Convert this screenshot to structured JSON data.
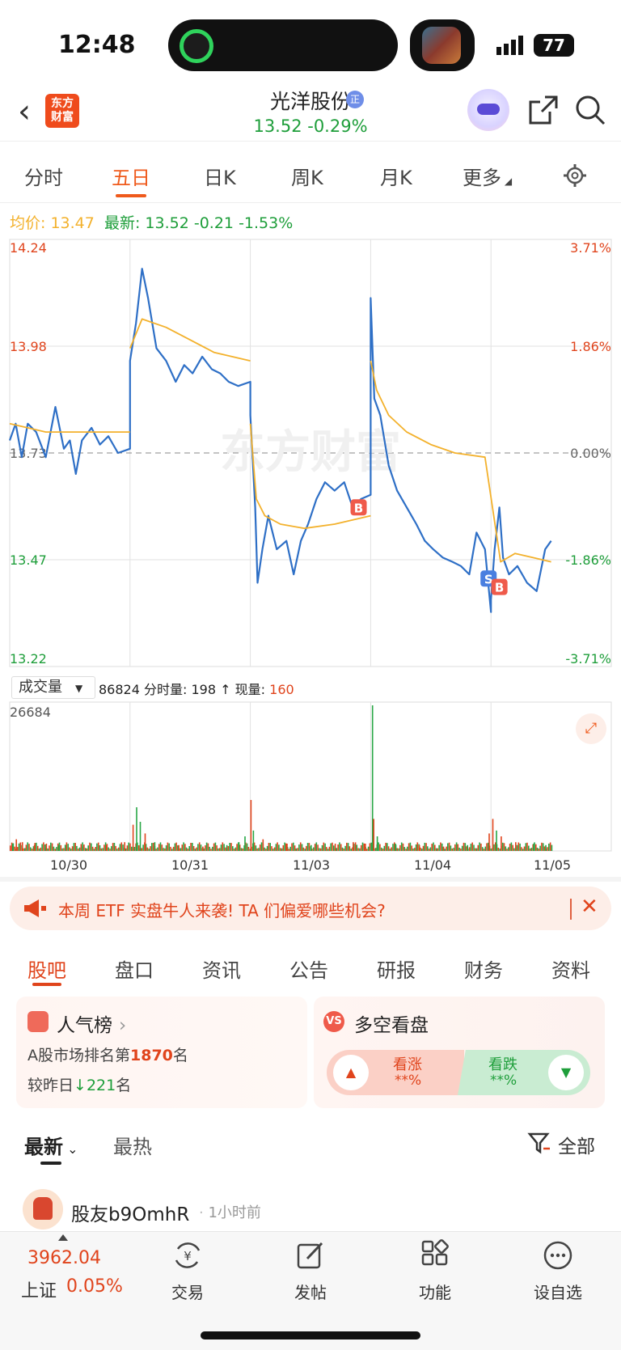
{
  "status_bar": {
    "time": "12:48",
    "battery": "77"
  },
  "header": {
    "logo": [
      "东方",
      "财富"
    ],
    "stock_name": "光洋股份",
    "stock_badge": "正",
    "price_line": "13.52  -0.29%"
  },
  "period_tabs": [
    {
      "label": "分时",
      "active": false
    },
    {
      "label": "五日",
      "active": true
    },
    {
      "label": "日K",
      "active": false
    },
    {
      "label": "周K",
      "active": false
    },
    {
      "label": "月K",
      "active": false
    },
    {
      "label": "更多",
      "active": false
    }
  ],
  "info_line": {
    "avg_label": "均价:",
    "avg_value": "13.47",
    "latest_label": "最新:",
    "latest_value": "13.52",
    "change": "-0.21",
    "change_pct": "-1.53%"
  },
  "chart_data": {
    "type": "line",
    "title": "",
    "watermark": "东方财富",
    "days": [
      "10/30",
      "10/31",
      "11/03",
      "11/04",
      "11/05"
    ],
    "ylim": [
      13.22,
      14.24
    ],
    "y_ticks_left": [
      "14.24",
      "13.98",
      "13.73",
      "13.47",
      "13.22"
    ],
    "y_ticks_right": [
      "3.71%",
      "1.86%",
      "0.00%",
      "-1.86%",
      "-3.71%"
    ],
    "series": [
      {
        "name": "price",
        "color": "#2e6fc6",
        "points": [
          [
            0.0,
            13.76
          ],
          [
            0.05,
            13.8
          ],
          [
            0.1,
            13.72
          ],
          [
            0.15,
            13.8
          ],
          [
            0.22,
            13.78
          ],
          [
            0.3,
            13.72
          ],
          [
            0.38,
            13.84
          ],
          [
            0.45,
            13.74
          ],
          [
            0.5,
            13.76
          ],
          [
            0.55,
            13.68
          ],
          [
            0.6,
            13.76
          ],
          [
            0.68,
            13.79
          ],
          [
            0.75,
            13.75
          ],
          [
            0.82,
            13.77
          ],
          [
            0.9,
            13.73
          ],
          [
            1.0,
            13.74
          ],
          [
            1.0,
            13.95
          ],
          [
            1.05,
            14.04
          ],
          [
            1.1,
            14.17
          ],
          [
            1.15,
            14.1
          ],
          [
            1.22,
            13.98
          ],
          [
            1.3,
            13.95
          ],
          [
            1.38,
            13.9
          ],
          [
            1.45,
            13.94
          ],
          [
            1.52,
            13.92
          ],
          [
            1.6,
            13.96
          ],
          [
            1.68,
            13.93
          ],
          [
            1.75,
            13.92
          ],
          [
            1.82,
            13.9
          ],
          [
            1.9,
            13.89
          ],
          [
            2.0,
            13.9
          ],
          [
            2.0,
            13.82
          ],
          [
            2.04,
            13.6
          ],
          [
            2.06,
            13.42
          ],
          [
            2.1,
            13.5
          ],
          [
            2.15,
            13.58
          ],
          [
            2.22,
            13.5
          ],
          [
            2.3,
            13.52
          ],
          [
            2.36,
            13.44
          ],
          [
            2.42,
            13.52
          ],
          [
            2.48,
            13.56
          ],
          [
            2.55,
            13.62
          ],
          [
            2.62,
            13.66
          ],
          [
            2.7,
            13.64
          ],
          [
            2.78,
            13.66
          ],
          [
            2.85,
            13.6
          ],
          [
            2.92,
            13.62
          ],
          [
            3.0,
            13.63
          ],
          [
            3.0,
            14.1
          ],
          [
            3.03,
            13.86
          ],
          [
            3.08,
            13.82
          ],
          [
            3.15,
            13.7
          ],
          [
            3.22,
            13.64
          ],
          [
            3.3,
            13.6
          ],
          [
            3.38,
            13.56
          ],
          [
            3.45,
            13.52
          ],
          [
            3.52,
            13.5
          ],
          [
            3.6,
            13.48
          ],
          [
            3.68,
            13.47
          ],
          [
            3.75,
            13.46
          ],
          [
            3.82,
            13.44
          ],
          [
            3.88,
            13.54
          ],
          [
            3.95,
            13.5
          ],
          [
            4.0,
            13.35
          ],
          [
            4.0,
            13.38
          ],
          [
            4.03,
            13.5
          ],
          [
            4.07,
            13.6
          ],
          [
            4.1,
            13.48
          ],
          [
            4.15,
            13.44
          ],
          [
            4.22,
            13.46
          ],
          [
            4.3,
            13.42
          ],
          [
            4.38,
            13.4
          ],
          [
            4.45,
            13.5
          ],
          [
            4.5,
            13.52
          ]
        ]
      },
      {
        "name": "avg",
        "color": "#f3b12c",
        "points": [
          [
            0.0,
            13.8
          ],
          [
            0.15,
            13.79
          ],
          [
            0.3,
            13.78
          ],
          [
            0.5,
            13.78
          ],
          [
            0.7,
            13.78
          ],
          [
            1.0,
            13.78
          ],
          [
            1.0,
            13.98
          ],
          [
            1.1,
            14.05
          ],
          [
            1.3,
            14.03
          ],
          [
            1.5,
            14.0
          ],
          [
            1.7,
            13.97
          ],
          [
            2.0,
            13.95
          ],
          [
            2.0,
            13.8
          ],
          [
            2.05,
            13.62
          ],
          [
            2.12,
            13.58
          ],
          [
            2.25,
            13.56
          ],
          [
            2.45,
            13.55
          ],
          [
            2.7,
            13.56
          ],
          [
            3.0,
            13.58
          ],
          [
            3.0,
            13.95
          ],
          [
            3.05,
            13.88
          ],
          [
            3.15,
            13.82
          ],
          [
            3.3,
            13.78
          ],
          [
            3.5,
            13.75
          ],
          [
            3.7,
            13.73
          ],
          [
            3.95,
            13.72
          ],
          [
            4.08,
            13.47
          ],
          [
            4.2,
            13.49
          ],
          [
            4.35,
            13.48
          ],
          [
            4.5,
            13.47
          ]
        ]
      }
    ],
    "trade_markers": [
      {
        "label": "B",
        "day_pos": 2.9,
        "price": 13.6
      },
      {
        "label": "S",
        "day_pos": 3.98,
        "price": 13.43
      },
      {
        "label": "B",
        "day_pos": 4.07,
        "price": 13.41
      }
    ],
    "volume": {
      "selector_label": "成交量",
      "total": "86824",
      "info_label": "分时量:",
      "info_value": "198",
      "current_label": "现量:",
      "current_value": "160",
      "ymax_label": "26684",
      "bars": [
        [
          0.02,
          5
        ],
        [
          0.05,
          8
        ],
        [
          0.1,
          6
        ],
        [
          0.2,
          4
        ],
        [
          0.3,
          5
        ],
        [
          0.4,
          4
        ],
        [
          0.6,
          3
        ],
        [
          0.8,
          4
        ],
        [
          0.95,
          6
        ],
        [
          1.02,
          18
        ],
        [
          1.05,
          30
        ],
        [
          1.08,
          20
        ],
        [
          1.12,
          12
        ],
        [
          1.2,
          6
        ],
        [
          1.4,
          4
        ],
        [
          1.6,
          3
        ],
        [
          1.8,
          4
        ],
        [
          1.9,
          6
        ],
        [
          1.95,
          10
        ],
        [
          2.0,
          35
        ],
        [
          2.02,
          14
        ],
        [
          2.1,
          8
        ],
        [
          2.3,
          5
        ],
        [
          2.5,
          4
        ],
        [
          2.7,
          5
        ],
        [
          2.85,
          6
        ],
        [
          2.95,
          5
        ],
        [
          3.01,
          100
        ],
        [
          3.02,
          22
        ],
        [
          3.05,
          10
        ],
        [
          3.2,
          5
        ],
        [
          3.4,
          4
        ],
        [
          3.6,
          3
        ],
        [
          3.8,
          4
        ],
        [
          3.98,
          12
        ],
        [
          4.01,
          22
        ],
        [
          4.04,
          14
        ],
        [
          4.08,
          10
        ],
        [
          4.2,
          6
        ],
        [
          4.35,
          5
        ],
        [
          4.45,
          4
        ]
      ]
    }
  },
  "banner": {
    "text": "本周 ETF 实盘牛人来袭! TA 们偏爱哪些机会?"
  },
  "section_tabs": [
    {
      "label": "股吧",
      "active": true
    },
    {
      "label": "盘口",
      "active": false
    },
    {
      "label": "资讯",
      "active": false
    },
    {
      "label": "公告",
      "active": false
    },
    {
      "label": "研报",
      "active": false
    },
    {
      "label": "财务",
      "active": false
    },
    {
      "label": "资料",
      "active": false
    }
  ],
  "popularity": {
    "title": "人气榜",
    "rank_prefix": "A股市场排名第",
    "rank": "1870",
    "rank_suffix": "名",
    "change_prefix": "较昨日",
    "change": "221",
    "change_suffix": "名"
  },
  "vs": {
    "title": "多空看盘",
    "up_label": "看涨",
    "up_value": "**%",
    "down_label": "看跌",
    "down_value": "**%"
  },
  "feed": {
    "tab_latest": "最新",
    "tab_hot": "最热",
    "filter_label": "全部",
    "post": {
      "user": "股友b9OmhR",
      "time": "1小时前"
    }
  },
  "bottom_bar": {
    "index_value": "3962.04",
    "index_name": "上证",
    "index_pct": "0.05%",
    "items": [
      {
        "label": "交易",
        "icon": "trade-icon"
      },
      {
        "label": "发帖",
        "icon": "compose-icon"
      },
      {
        "label": "功能",
        "icon": "apps-icon"
      },
      {
        "label": "设自选",
        "icon": "more-icon"
      }
    ]
  },
  "colors": {
    "accent": "#ef5a1c",
    "up": "#e0441c",
    "down": "#1e9e3a",
    "price_line": "#2e6fc6",
    "avg_line": "#f3b12c"
  }
}
